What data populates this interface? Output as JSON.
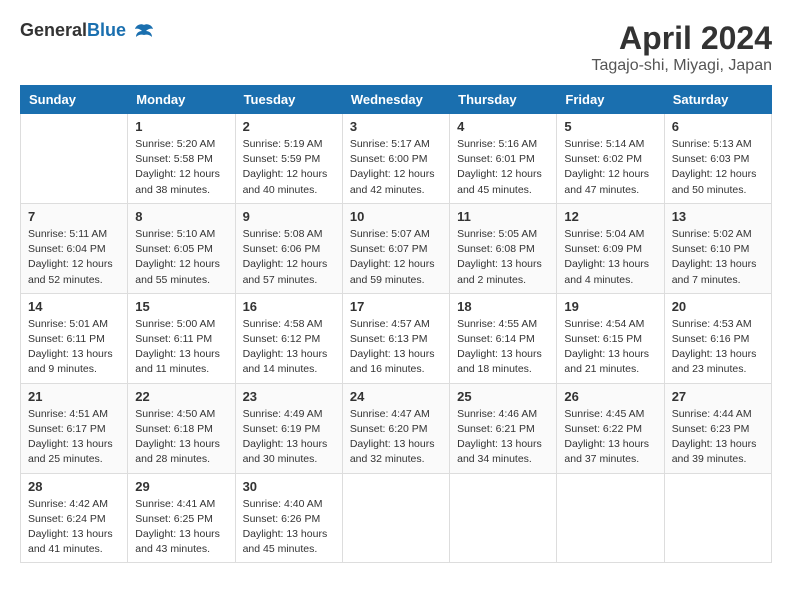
{
  "header": {
    "logo_general": "General",
    "logo_blue": "Blue",
    "month_year": "April 2024",
    "location": "Tagajo-shi, Miyagi, Japan"
  },
  "days_of_week": [
    "Sunday",
    "Monday",
    "Tuesday",
    "Wednesday",
    "Thursday",
    "Friday",
    "Saturday"
  ],
  "weeks": [
    [
      {
        "day": "",
        "info": ""
      },
      {
        "day": "1",
        "info": "Sunrise: 5:20 AM\nSunset: 5:58 PM\nDaylight: 12 hours\nand 38 minutes."
      },
      {
        "day": "2",
        "info": "Sunrise: 5:19 AM\nSunset: 5:59 PM\nDaylight: 12 hours\nand 40 minutes."
      },
      {
        "day": "3",
        "info": "Sunrise: 5:17 AM\nSunset: 6:00 PM\nDaylight: 12 hours\nand 42 minutes."
      },
      {
        "day": "4",
        "info": "Sunrise: 5:16 AM\nSunset: 6:01 PM\nDaylight: 12 hours\nand 45 minutes."
      },
      {
        "day": "5",
        "info": "Sunrise: 5:14 AM\nSunset: 6:02 PM\nDaylight: 12 hours\nand 47 minutes."
      },
      {
        "day": "6",
        "info": "Sunrise: 5:13 AM\nSunset: 6:03 PM\nDaylight: 12 hours\nand 50 minutes."
      }
    ],
    [
      {
        "day": "7",
        "info": "Sunrise: 5:11 AM\nSunset: 6:04 PM\nDaylight: 12 hours\nand 52 minutes."
      },
      {
        "day": "8",
        "info": "Sunrise: 5:10 AM\nSunset: 6:05 PM\nDaylight: 12 hours\nand 55 minutes."
      },
      {
        "day": "9",
        "info": "Sunrise: 5:08 AM\nSunset: 6:06 PM\nDaylight: 12 hours\nand 57 minutes."
      },
      {
        "day": "10",
        "info": "Sunrise: 5:07 AM\nSunset: 6:07 PM\nDaylight: 12 hours\nand 59 minutes."
      },
      {
        "day": "11",
        "info": "Sunrise: 5:05 AM\nSunset: 6:08 PM\nDaylight: 13 hours\nand 2 minutes."
      },
      {
        "day": "12",
        "info": "Sunrise: 5:04 AM\nSunset: 6:09 PM\nDaylight: 13 hours\nand 4 minutes."
      },
      {
        "day": "13",
        "info": "Sunrise: 5:02 AM\nSunset: 6:10 PM\nDaylight: 13 hours\nand 7 minutes."
      }
    ],
    [
      {
        "day": "14",
        "info": "Sunrise: 5:01 AM\nSunset: 6:11 PM\nDaylight: 13 hours\nand 9 minutes."
      },
      {
        "day": "15",
        "info": "Sunrise: 5:00 AM\nSunset: 6:11 PM\nDaylight: 13 hours\nand 11 minutes."
      },
      {
        "day": "16",
        "info": "Sunrise: 4:58 AM\nSunset: 6:12 PM\nDaylight: 13 hours\nand 14 minutes."
      },
      {
        "day": "17",
        "info": "Sunrise: 4:57 AM\nSunset: 6:13 PM\nDaylight: 13 hours\nand 16 minutes."
      },
      {
        "day": "18",
        "info": "Sunrise: 4:55 AM\nSunset: 6:14 PM\nDaylight: 13 hours\nand 18 minutes."
      },
      {
        "day": "19",
        "info": "Sunrise: 4:54 AM\nSunset: 6:15 PM\nDaylight: 13 hours\nand 21 minutes."
      },
      {
        "day": "20",
        "info": "Sunrise: 4:53 AM\nSunset: 6:16 PM\nDaylight: 13 hours\nand 23 minutes."
      }
    ],
    [
      {
        "day": "21",
        "info": "Sunrise: 4:51 AM\nSunset: 6:17 PM\nDaylight: 13 hours\nand 25 minutes."
      },
      {
        "day": "22",
        "info": "Sunrise: 4:50 AM\nSunset: 6:18 PM\nDaylight: 13 hours\nand 28 minutes."
      },
      {
        "day": "23",
        "info": "Sunrise: 4:49 AM\nSunset: 6:19 PM\nDaylight: 13 hours\nand 30 minutes."
      },
      {
        "day": "24",
        "info": "Sunrise: 4:47 AM\nSunset: 6:20 PM\nDaylight: 13 hours\nand 32 minutes."
      },
      {
        "day": "25",
        "info": "Sunrise: 4:46 AM\nSunset: 6:21 PM\nDaylight: 13 hours\nand 34 minutes."
      },
      {
        "day": "26",
        "info": "Sunrise: 4:45 AM\nSunset: 6:22 PM\nDaylight: 13 hours\nand 37 minutes."
      },
      {
        "day": "27",
        "info": "Sunrise: 4:44 AM\nSunset: 6:23 PM\nDaylight: 13 hours\nand 39 minutes."
      }
    ],
    [
      {
        "day": "28",
        "info": "Sunrise: 4:42 AM\nSunset: 6:24 PM\nDaylight: 13 hours\nand 41 minutes."
      },
      {
        "day": "29",
        "info": "Sunrise: 4:41 AM\nSunset: 6:25 PM\nDaylight: 13 hours\nand 43 minutes."
      },
      {
        "day": "30",
        "info": "Sunrise: 4:40 AM\nSunset: 6:26 PM\nDaylight: 13 hours\nand 45 minutes."
      },
      {
        "day": "",
        "info": ""
      },
      {
        "day": "",
        "info": ""
      },
      {
        "day": "",
        "info": ""
      },
      {
        "day": "",
        "info": ""
      }
    ]
  ]
}
